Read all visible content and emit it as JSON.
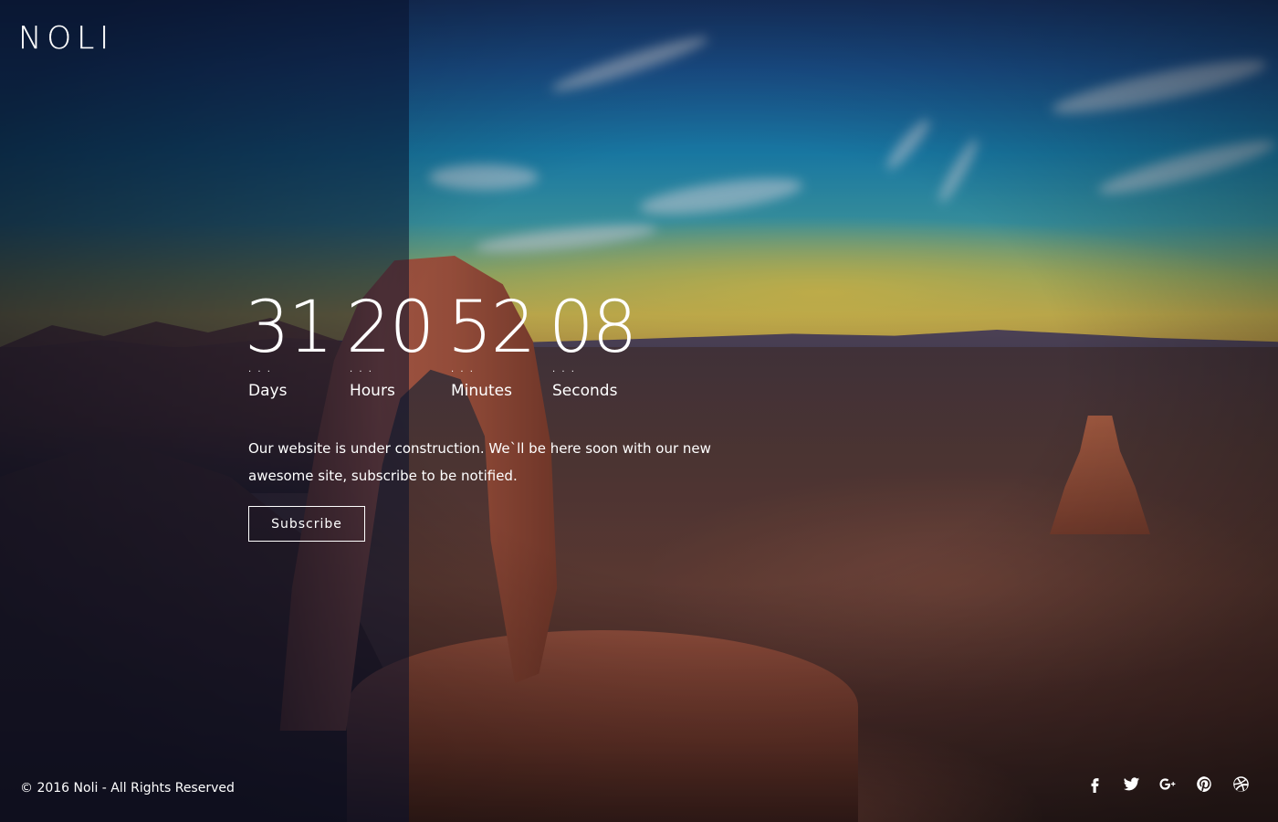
{
  "brand": {
    "logo_text": "NOLI"
  },
  "countdown": [
    {
      "value": "31",
      "label": "Days"
    },
    {
      "value": "20",
      "label": "Hours"
    },
    {
      "value": "52",
      "label": "Minutes"
    },
    {
      "value": "08",
      "label": "Seconds"
    }
  ],
  "message": "Our website is under construction. We`ll be here soon with our new awesome site, subscribe to be notified.",
  "subscribe_label": "Subscribe",
  "footer": {
    "copyright": "© 2016 Noli - All Rights Reserved"
  },
  "social": [
    {
      "icon": "facebook-icon"
    },
    {
      "icon": "twitter-icon"
    },
    {
      "icon": "google-plus-icon"
    },
    {
      "icon": "pinterest-icon"
    },
    {
      "icon": "dribbble-icon"
    }
  ],
  "colors": {
    "text": "#ffffff",
    "panel_overlay": "#0a122d"
  }
}
